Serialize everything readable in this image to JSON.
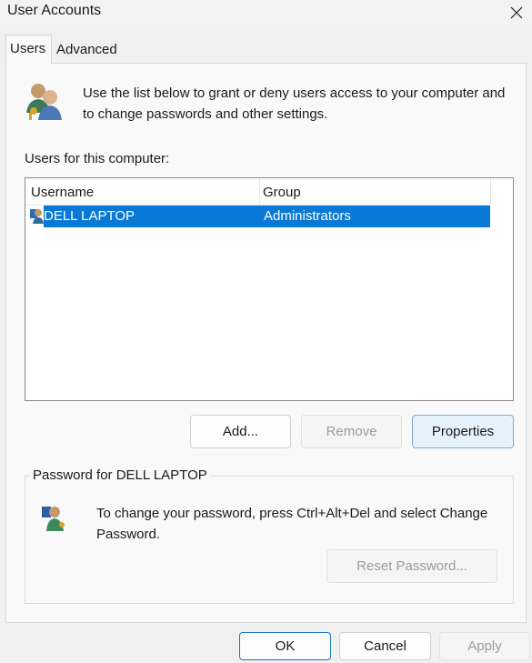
{
  "window": {
    "title": "User Accounts",
    "close_icon": "close-icon"
  },
  "tabs": [
    {
      "label": "Users",
      "active": true
    },
    {
      "label": "Advanced",
      "active": false
    }
  ],
  "intro": {
    "icon": "users-icon",
    "text": "Use the list below to grant or deny users access to your computer and to change passwords and other settings."
  },
  "users_list": {
    "label": "Users for this computer:",
    "columns": [
      "Username",
      "Group"
    ],
    "rows": [
      {
        "icon": "user-icon",
        "username": "DELL LAPTOP",
        "group": "Administrators",
        "selected": true
      }
    ]
  },
  "list_buttons": {
    "add": "Add...",
    "remove": "Remove",
    "properties": "Properties"
  },
  "password_group": {
    "legend": "Password for DELL LAPTOP",
    "icon": "user-key-icon",
    "text": "To change your password, press Ctrl+Alt+Del and select Change Password.",
    "reset_button": "Reset Password..."
  },
  "footer": {
    "ok": "OK",
    "cancel": "Cancel",
    "apply": "Apply"
  },
  "colors": {
    "selection": "#0a78d7",
    "accent": "#1a6fc4"
  }
}
